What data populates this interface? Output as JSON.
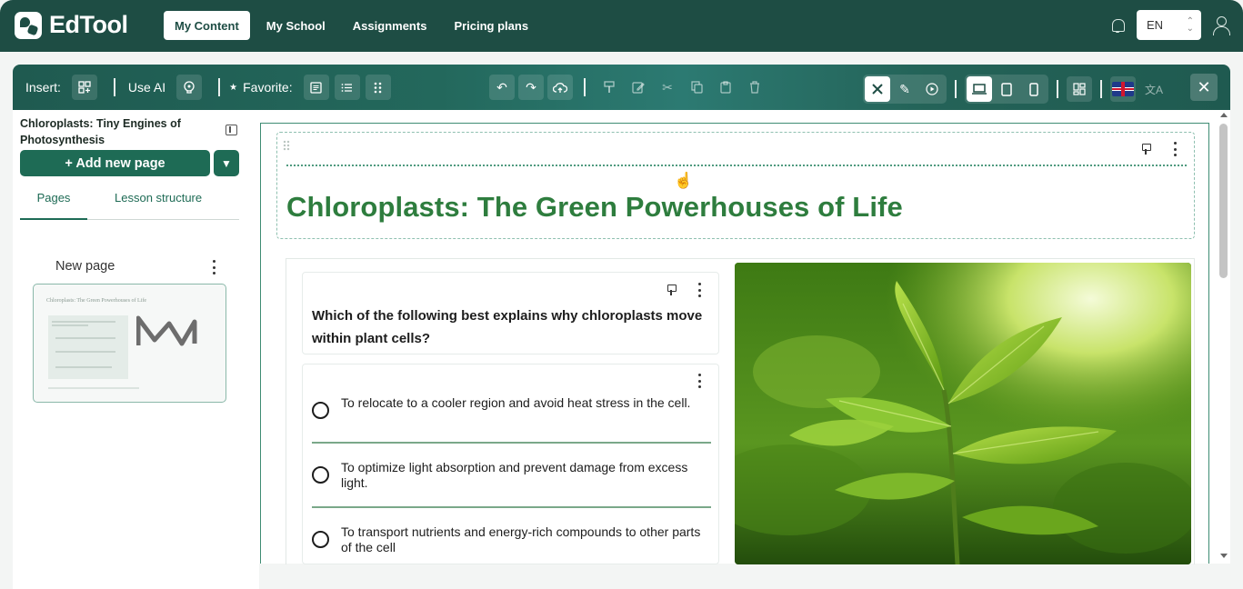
{
  "app": {
    "name": "EdTool"
  },
  "nav": {
    "links": [
      "My Content",
      "My School",
      "Assignments",
      "Pricing plans"
    ],
    "active": "My Content",
    "language": "EN"
  },
  "toolbar": {
    "insert_label": "Insert:",
    "use_ai_label": "Use AI",
    "favorite_label": "Favorite:",
    "favorite_star": "★"
  },
  "sidebar": {
    "document_title": "Chloroplasts: Tiny Engines of Photosynthesis",
    "add_page_label": "+ Add new page",
    "tabs": [
      "Pages",
      "Lesson structure"
    ],
    "active_tab": "Pages",
    "pages": [
      {
        "label": "New page",
        "thumbnail_title": "Chloroplasts: The Green Powerhouses of Life"
      }
    ]
  },
  "content": {
    "heading": "Chloroplasts: The Green Powerhouses of Life",
    "question": "Which of the following best explains why chloroplasts move within plant cells?",
    "options": [
      "To relocate to a cooler region and avoid heat stress in the cell.",
      "To optimize light absorption and prevent damage from excess light.",
      "To transport nutrients and energy-rich compounds to other parts of the cell"
    ]
  },
  "colors": {
    "nav_bg": "#1e4d44",
    "accent": "#1e6b55",
    "heading": "#2e7d3e"
  }
}
